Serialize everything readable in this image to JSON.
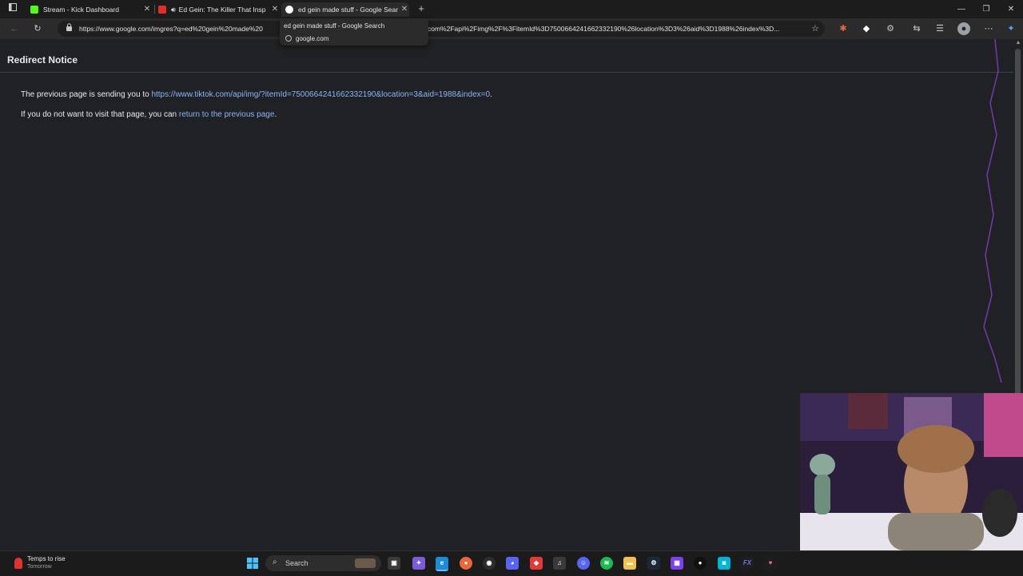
{
  "tabs": [
    {
      "title": "Stream - Kick Dashboard",
      "favicon": "kick-icon",
      "close": "✕"
    },
    {
      "title": "Ed Gein: The Killer That Insp",
      "favicon": "youtube-icon",
      "close": "✕"
    },
    {
      "title": "ed gein made stuff - Google Sear",
      "favicon": "google-icon",
      "close": "✕",
      "active": true
    }
  ],
  "new_tab": "+",
  "tab_hover_card": {
    "title": "ed gein made stuff - Google Search",
    "domain": "google.com"
  },
  "address_bar": {
    "url_left": "https://www.google.com/imgres?q=ed%20gein%20made%20",
    "url_right": "com%2Fapi%2Fimg%2F%3FitemId%3D7500664241662332190%26location%3D3%26aid%3D1988%26index%3D..."
  },
  "page": {
    "title": "Redirect Notice",
    "sending_prefix": "The previous page is sending you to ",
    "target_link": "https://www.tiktok.com/api/img/?itemId=7500664241662332190&location=3&aid=1988&index=0",
    "sending_suffix": ".",
    "return_prefix": "If you do not want to visit that page, you can ",
    "return_link": "return to the previous page",
    "return_suffix": "."
  },
  "taskbar": {
    "weather_title": "Temps to rise",
    "weather_sub": "Tomorrow",
    "search_placeholder": "Search",
    "fx_label": "FX"
  },
  "colors": {
    "background": "#202124",
    "link": "#8ab4f8",
    "tabstrip": "#1c1c1c",
    "kick_green": "#53fc18"
  }
}
